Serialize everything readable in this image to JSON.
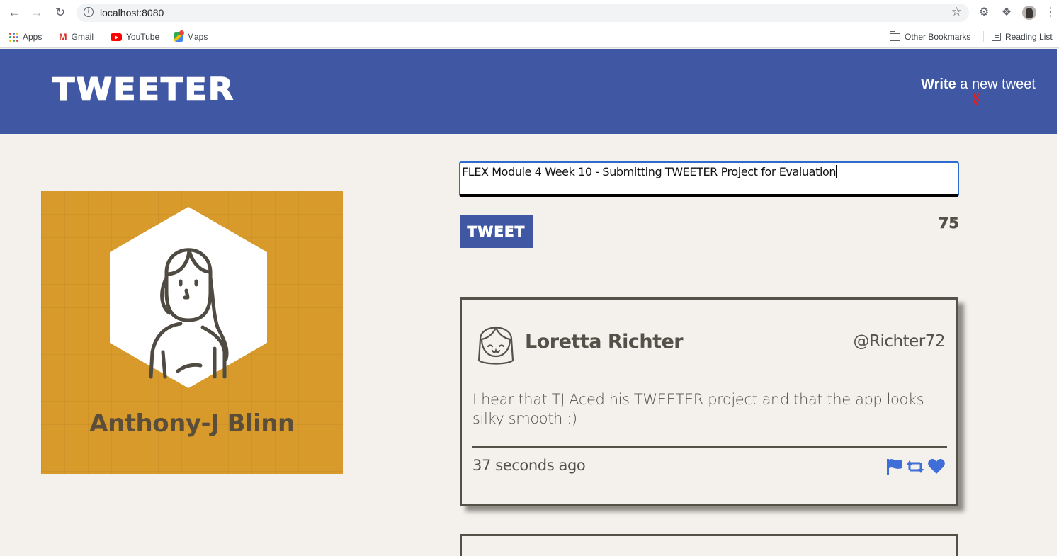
{
  "browser": {
    "url": "localhost:8080",
    "bookmarks": [
      {
        "label": "Apps",
        "icon": "apps-grid-icon"
      },
      {
        "label": "Gmail",
        "icon": "gmail-icon"
      },
      {
        "label": "YouTube",
        "icon": "youtube-icon"
      },
      {
        "label": "Maps",
        "icon": "maps-icon"
      }
    ],
    "other_bookmarks": "Other Bookmarks",
    "reading_list": "Reading List"
  },
  "header": {
    "brand": "TWEETER",
    "write_bold": "Write",
    "write_rest": " a new tweet",
    "accent": "#4057a3",
    "chevron_color": "#e02020"
  },
  "profile": {
    "name": "Anthony-J Blinn",
    "card_color": "#d79a2b"
  },
  "composer": {
    "text": "FLEX Module 4 Week 10 - Submitting TWEETER Project for Evaluation",
    "button_label": "TWEET",
    "counter": "75"
  },
  "tweets": [
    {
      "name": "Loretta Richter",
      "handle": "@Richter72",
      "body": "I hear that TJ Aced his TWEETER project and that the app looks silky smooth :)",
      "time": "37 seconds ago",
      "actions": [
        "flag-icon",
        "retweet-icon",
        "heart-icon"
      ],
      "action_color": "#3f6ed8"
    }
  ]
}
